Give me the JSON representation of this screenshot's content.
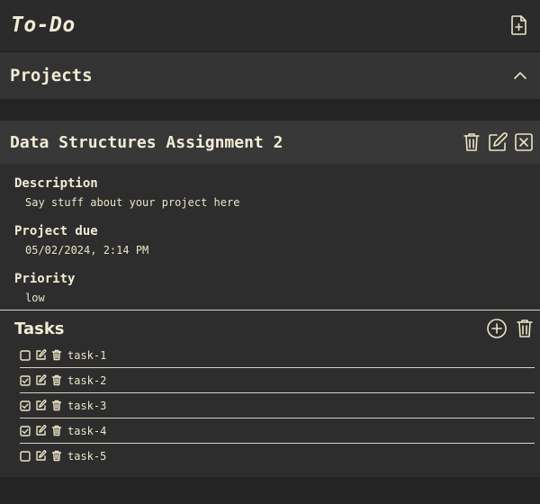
{
  "header": {
    "title": "To-Do",
    "new_project_icon": "file-plus-icon"
  },
  "projects": {
    "title": "Projects",
    "collapse_icon": "chevron-up-icon"
  },
  "project": {
    "name": "Data Structures Assignment 2",
    "description_label": "Description",
    "description": "Say stuff about your project here",
    "due_label": "Project due",
    "due": "05/02/2024, 2:14 PM",
    "priority_label": "Priority",
    "priority": "low",
    "actions": [
      "trash-icon",
      "edit-icon",
      "close-icon"
    ]
  },
  "tasks": {
    "title": "Tasks",
    "items": [
      {
        "label": "task-1",
        "checked": false
      },
      {
        "label": "task-2",
        "checked": true
      },
      {
        "label": "task-3",
        "checked": true
      },
      {
        "label": "task-4",
        "checked": true
      },
      {
        "label": "task-5",
        "checked": false
      }
    ]
  },
  "colors": {
    "background": "#242424",
    "panel": "#333333",
    "text": "#ece4c8"
  }
}
